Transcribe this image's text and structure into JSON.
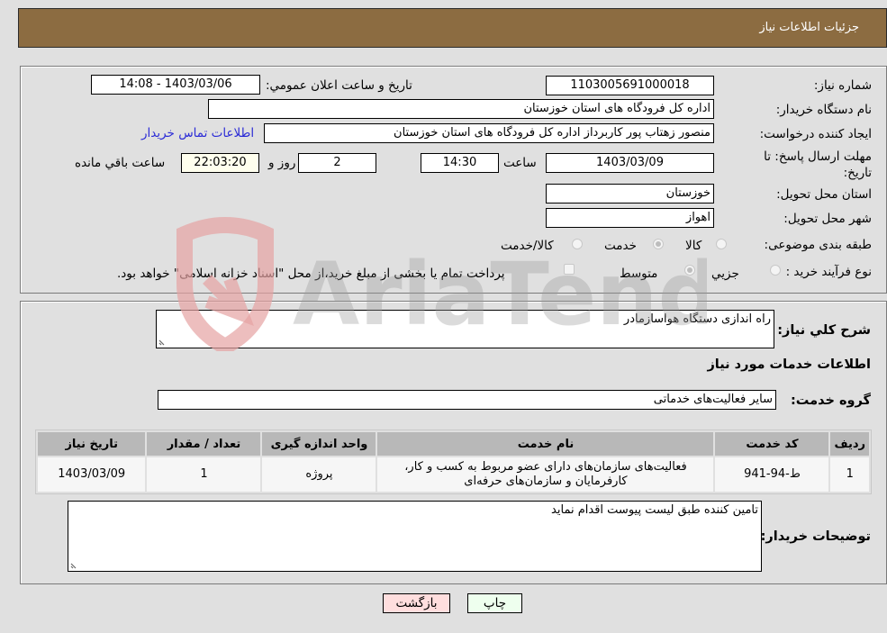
{
  "header": {
    "title": "جزئيات اطلاعات نياز"
  },
  "details": {
    "need_number": {
      "label": "شماره نياز:",
      "value": "1103005691000018"
    },
    "announce_datetime": {
      "label": "تاريخ و ساعت اعلان عمومي:",
      "value": "1403/03/06 - 14:08"
    },
    "buyer_org": {
      "label": "نام دستگاه خريدار:",
      "value": "اداره کل فرودگاه های استان خوزستان"
    },
    "requester": {
      "label": "ايجاد کننده درخواست:",
      "value": "منصور زهتاب پور کاربرداز اداره کل فرودگاه های استان خوزستان"
    },
    "buyer_contact_link": "اطلاعات تماس خريدار",
    "deadline": {
      "label": "مهلت ارسال پاسخ: تا تاريخ:",
      "date": "1403/03/09",
      "time_label": "ساعت",
      "time": "14:30",
      "days": "2",
      "days_label": "روز و",
      "remaining": "22:03:20",
      "remaining_label": "ساعت باقي مانده"
    },
    "delivery_province": {
      "label": "استان محل تحويل:",
      "value": "خوزستان"
    },
    "delivery_city": {
      "label": "شهر محل تحويل:",
      "value": "اهواز"
    },
    "category": {
      "label": "طبقه بندی موضوعی:",
      "options": [
        "کالا",
        "خدمت",
        "کالا/خدمت"
      ],
      "selected": "خدمت"
    },
    "purchase_type": {
      "label": "نوع فرآيند خريد :",
      "options": [
        "جزيي",
        "متوسط"
      ],
      "selected": "متوسط",
      "treasury_note": "پرداخت تمام يا بخشی از مبلغ خريد،از محل \"اسناد خزانه اسلامی\" خواهد بود.",
      "treasury_checked": false
    }
  },
  "description": {
    "label": "شرح کلي نياز:",
    "value": "راه اندازی دستگاه هواسازمادر"
  },
  "services_heading": "اطلاعات خدمات مورد نياز",
  "service_group": {
    "label": "گروه خدمت:",
    "value": "ساير فعاليت‌های خدماتی"
  },
  "table": {
    "columns": [
      "رديف",
      "کد خدمت",
      "نام خدمت",
      "واحد اندازه گيری",
      "تعداد / مقدار",
      "تاريخ نياز"
    ],
    "rows": [
      {
        "row": "1",
        "code": "ط-94-941",
        "name": "فعاليت‌های سازمان‌های دارای عضو مربوط به کسب و کار، کارفرمايان و سازمان‌های حرفه‌ای",
        "unit": "پروژه",
        "quantity": "1",
        "date": "1403/03/09"
      }
    ]
  },
  "buyer_notes": {
    "label": "توضيحات خريدار:",
    "value": "تامين کننده طبق ليست پيوست اقدام نمايد"
  },
  "buttons": {
    "print": "چاپ",
    "back": "بازگشت"
  },
  "watermark": {
    "text": "AriaTender.neT"
  }
}
